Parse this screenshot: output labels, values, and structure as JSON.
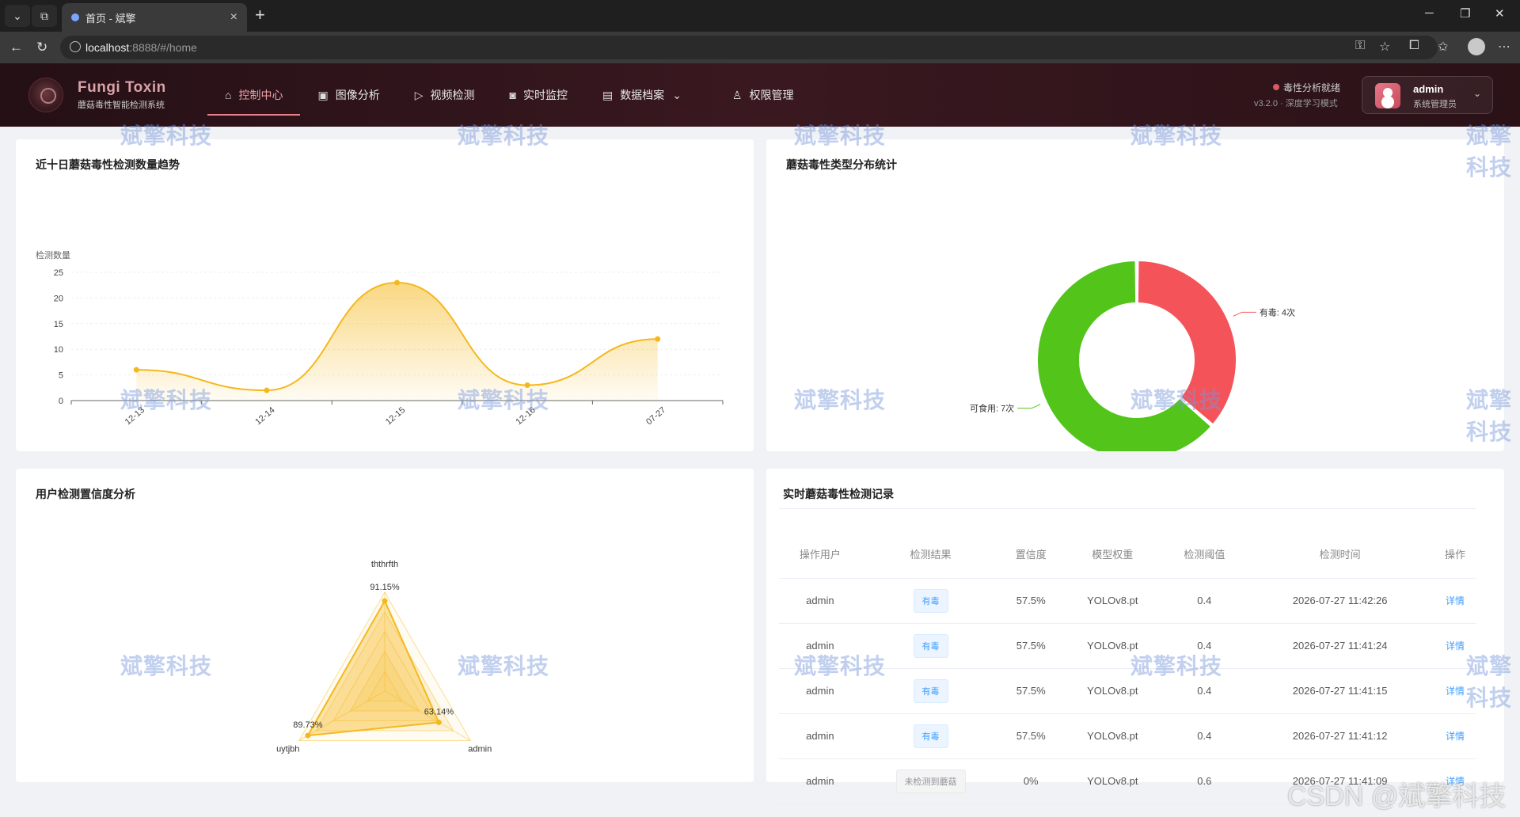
{
  "browser": {
    "tab_title": "首页 - 斌擎",
    "url_host": "localhost",
    "url_path": ":8888/#/home"
  },
  "header": {
    "brand_title": "Fungi Toxin",
    "brand_sub": "蘑菇毒性智能检测系统",
    "nav": [
      {
        "label": "控制中心",
        "icon": "home-icon"
      },
      {
        "label": "图像分析",
        "icon": "image-icon"
      },
      {
        "label": "视频检测",
        "icon": "play-icon"
      },
      {
        "label": "实时监控",
        "icon": "camera-icon"
      },
      {
        "label": "数据档案",
        "icon": "document-icon"
      },
      {
        "label": "权限管理",
        "icon": "user-icon"
      }
    ],
    "status_text": "毒性分析就绪",
    "status_version": "v3.2.0 · 深度学习模式",
    "user_name": "admin",
    "user_role": "系统管理员"
  },
  "watermark": "斌擎科技",
  "trend": {
    "title": "近十日蘑菇毒性检测数量趋势",
    "chart_data": {
      "type": "area",
      "ylabel": "检测数量",
      "categories": [
        "12-13",
        "12-14",
        "12-15",
        "12-16",
        "07-27"
      ],
      "values": [
        6,
        2,
        23,
        3,
        12
      ],
      "ylim": [
        0,
        25
      ],
      "yticks": [
        "0",
        "5",
        "10",
        "15",
        "20",
        "25"
      ],
      "color": "#f5b81c"
    }
  },
  "donut": {
    "title": "蘑菇毒性类型分布统计",
    "chart_data": {
      "type": "pie",
      "slices": [
        {
          "name": "有毒",
          "value": 4,
          "label": "有毒: 4次",
          "color": "#f5535a"
        },
        {
          "name": "可食用",
          "value": 7,
          "label": "可食用: 7次",
          "color": "#52c41a"
        }
      ]
    }
  },
  "radar": {
    "title": "用户检测置信度分析",
    "chart_data": {
      "type": "radar",
      "indicators": [
        {
          "name": "ththrfth",
          "value": 91.15,
          "label": "91.15%"
        },
        {
          "name": "admin",
          "value": 63.14,
          "label": "63.14%"
        },
        {
          "name": "uytjbh",
          "value": 89.73,
          "label": "89.73%"
        }
      ],
      "max": 100,
      "color": "#f5b81c"
    }
  },
  "records": {
    "title": "实时蘑菇毒性检测记录",
    "columns": [
      "操作用户",
      "检测结果",
      "置信度",
      "模型权重",
      "检测阈值",
      "检测时间",
      "操作"
    ],
    "rows": [
      {
        "user": "admin",
        "result": "有毒",
        "conf": "57.5%",
        "model": "YOLOv8.pt",
        "thr": "0.4",
        "time": "2026-07-27 11:42:26",
        "op": "详情"
      },
      {
        "user": "admin",
        "result": "有毒",
        "conf": "57.5%",
        "model": "YOLOv8.pt",
        "thr": "0.4",
        "time": "2026-07-27 11:41:24",
        "op": "详情"
      },
      {
        "user": "admin",
        "result": "有毒",
        "conf": "57.5%",
        "model": "YOLOv8.pt",
        "thr": "0.4",
        "time": "2026-07-27 11:41:15",
        "op": "详情"
      },
      {
        "user": "admin",
        "result": "有毒",
        "conf": "57.5%",
        "model": "YOLOv8.pt",
        "thr": "0.4",
        "time": "2026-07-27 11:41:12",
        "op": "详情"
      },
      {
        "user": "admin",
        "result": "未检测到蘑菇",
        "conf": "0%",
        "model": "YOLOv8.pt",
        "thr": "0.6",
        "time": "2026-07-27 11:41:09",
        "op": "详情"
      }
    ]
  },
  "csdn_mark": "CSDN @斌擎科技"
}
